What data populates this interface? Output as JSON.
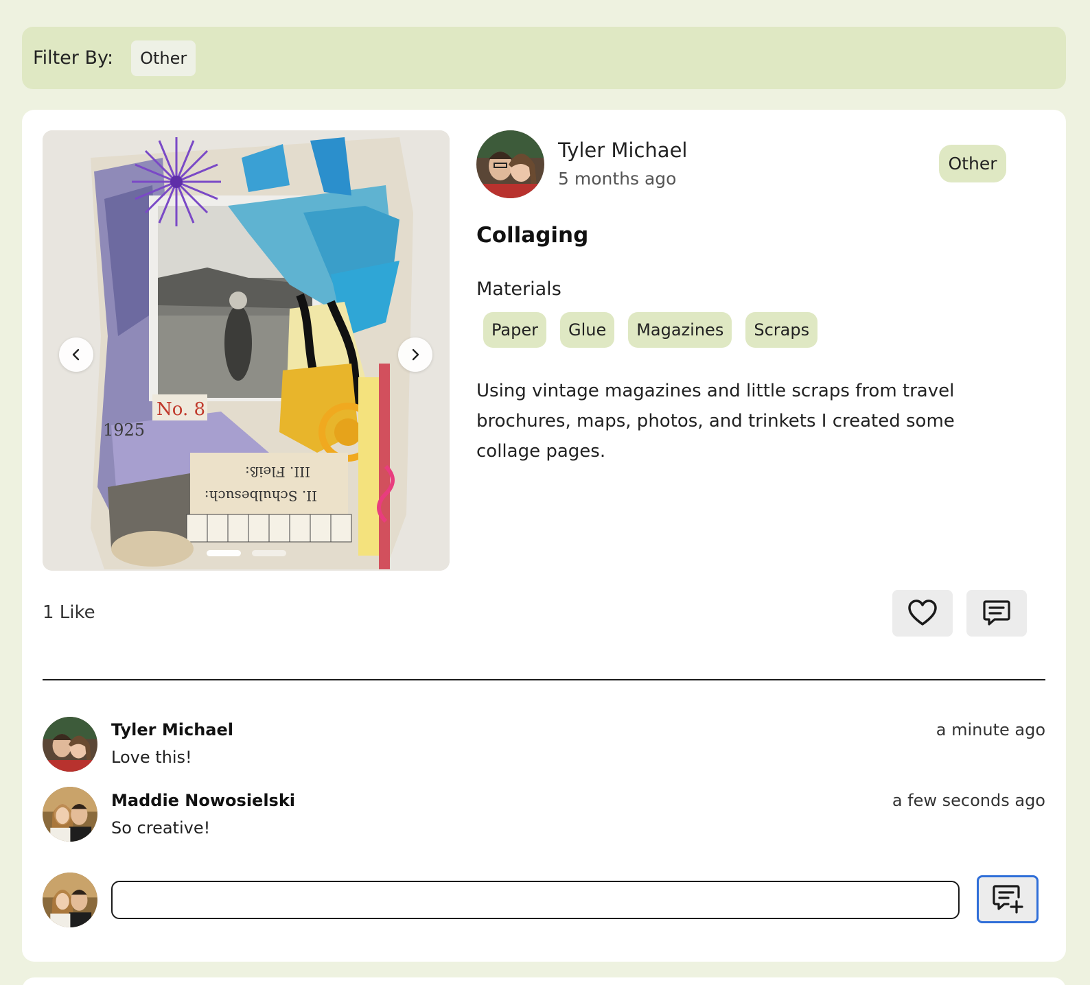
{
  "filter": {
    "label": "Filter By:",
    "chip": "Other"
  },
  "post": {
    "author": "Tyler Michael",
    "time": "5 months ago",
    "category": "Other",
    "title": "Collaging",
    "materials_label": "Materials",
    "materials": [
      "Paper",
      "Glue",
      "Magazines",
      "Scraps"
    ],
    "description": "Using vintage magazines and little scraps from travel brochures, maps, photos, and trinkets I created some collage pages.",
    "likes_text": "1 Like",
    "carousel": {
      "image_count": 2,
      "active_index": 0,
      "icons": [
        "chevron-left-icon",
        "chevron-right-icon"
      ]
    },
    "actions": {
      "like_icon": "heart-icon",
      "comment_icon": "comment-icon"
    }
  },
  "comments": [
    {
      "author": "Tyler Michael",
      "text": "Love this!",
      "time": "a minute ago"
    },
    {
      "author": "Maddie Nowosielski",
      "text": "So creative!",
      "time": "a few seconds ago"
    }
  ],
  "comment_form": {
    "value": "",
    "placeholder": "",
    "submit_icon": "comment-plus-icon"
  },
  "colors": {
    "page_background": "#eef2e0",
    "chip_green": "#dfe8c3",
    "card": "#ffffff",
    "focus_blue": "#2f6ed8"
  }
}
